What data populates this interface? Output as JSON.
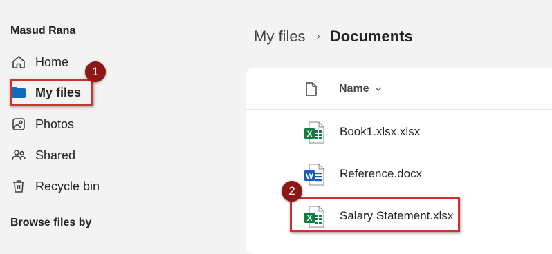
{
  "sidebar": {
    "user_name": "Masud Rana",
    "items": [
      {
        "label": "Home",
        "icon": "home-icon"
      },
      {
        "label": "My files",
        "icon": "folder-icon",
        "active": true
      },
      {
        "label": "Photos",
        "icon": "photo-icon"
      },
      {
        "label": "Shared",
        "icon": "people-icon"
      },
      {
        "label": "Recycle bin",
        "icon": "trash-icon"
      }
    ],
    "section_title": "Browse files by"
  },
  "breadcrumb": {
    "root": "My files",
    "separator": "›",
    "current": "Documents"
  },
  "file_list": {
    "column_name": "Name",
    "files": [
      {
        "name": "Book1.xlsx.xlsx",
        "type": "excel",
        "icon": "excel-file-icon"
      },
      {
        "name": "Reference.docx",
        "type": "word",
        "icon": "word-file-icon"
      },
      {
        "name": "Salary Statement.xlsx",
        "type": "excel",
        "icon": "excel-file-icon"
      }
    ]
  },
  "annotations": [
    {
      "number": "1",
      "target": "My files"
    },
    {
      "number": "2",
      "target": "Salary Statement.xlsx"
    }
  ],
  "colors": {
    "accent": "#0f6cbd",
    "excel": "#107c41",
    "word": "#185abd",
    "annotation": "#d32f2f",
    "badge": "#8b1717"
  }
}
